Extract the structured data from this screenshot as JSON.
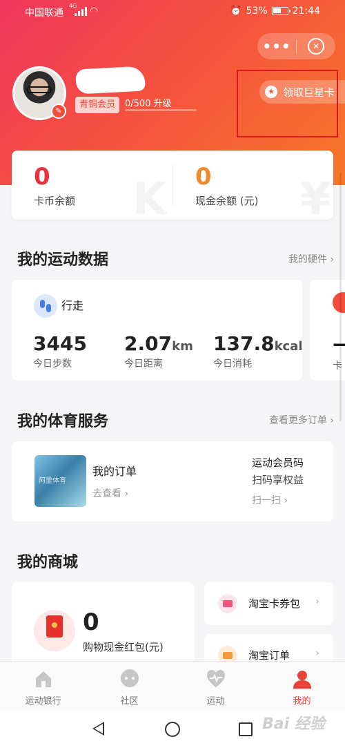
{
  "status_bar": {
    "carrier": "中国联通",
    "network": "4G",
    "battery": "53%",
    "time": "21:44"
  },
  "capsule": {
    "more_icon": "more-dots-icon",
    "close_icon": "close-target-icon"
  },
  "profile": {
    "member_level": "青铜会员",
    "progress_text": "0/500 升级",
    "progress_fraction": 0.0,
    "star_card_label": "领取巨星卡"
  },
  "balance": {
    "coin_value": "0",
    "coin_label": "卡币余额",
    "coin_color": "#e7343f",
    "cash_value": "0",
    "cash_label": "现金余额 (元)",
    "cash_color": "#f08a2a"
  },
  "sport": {
    "title": "我的运动数据",
    "link": "我的硬件",
    "activity": "行走",
    "stats": [
      {
        "value": "3445",
        "unit": "",
        "label": "今日步数"
      },
      {
        "value": "2.07",
        "unit": "km",
        "label": "今日距离"
      },
      {
        "value": "137.8",
        "unit": "kcal",
        "label": "今日消耗"
      }
    ],
    "next_card_partial": {
      "value": "—",
      "label": "卡"
    }
  },
  "services": {
    "title": "我的体育服务",
    "link": "查看更多订单",
    "order_title": "我的订单",
    "order_action": "去查看",
    "member_code_title": "运动会员码",
    "member_code_sub": "扫码享权益",
    "member_code_action": "扫一扫",
    "thumb_text": "阿里体育"
  },
  "mall": {
    "title": "我的商城",
    "redpack_value": "0",
    "redpack_label": "购物现金红包(元)",
    "items": [
      {
        "label": "淘宝卡券包",
        "icon": "coupon-icon",
        "color": "#f0567a"
      },
      {
        "label": "淘宝订单",
        "icon": "order-icon",
        "color": "#f59a3a"
      }
    ]
  },
  "tabs": [
    {
      "label": "运动银行",
      "icon": "home-icon",
      "active": false
    },
    {
      "label": "社区",
      "icon": "chat-icon",
      "active": false
    },
    {
      "label": "运动",
      "icon": "heart-pulse-icon",
      "active": false
    },
    {
      "label": "我的",
      "icon": "user-icon",
      "active": true
    }
  ],
  "colors": {
    "accent": "#f24d3a",
    "tab_active": "#e8433a",
    "tab_inactive": "#777777"
  },
  "watermark": "Bai 经验"
}
